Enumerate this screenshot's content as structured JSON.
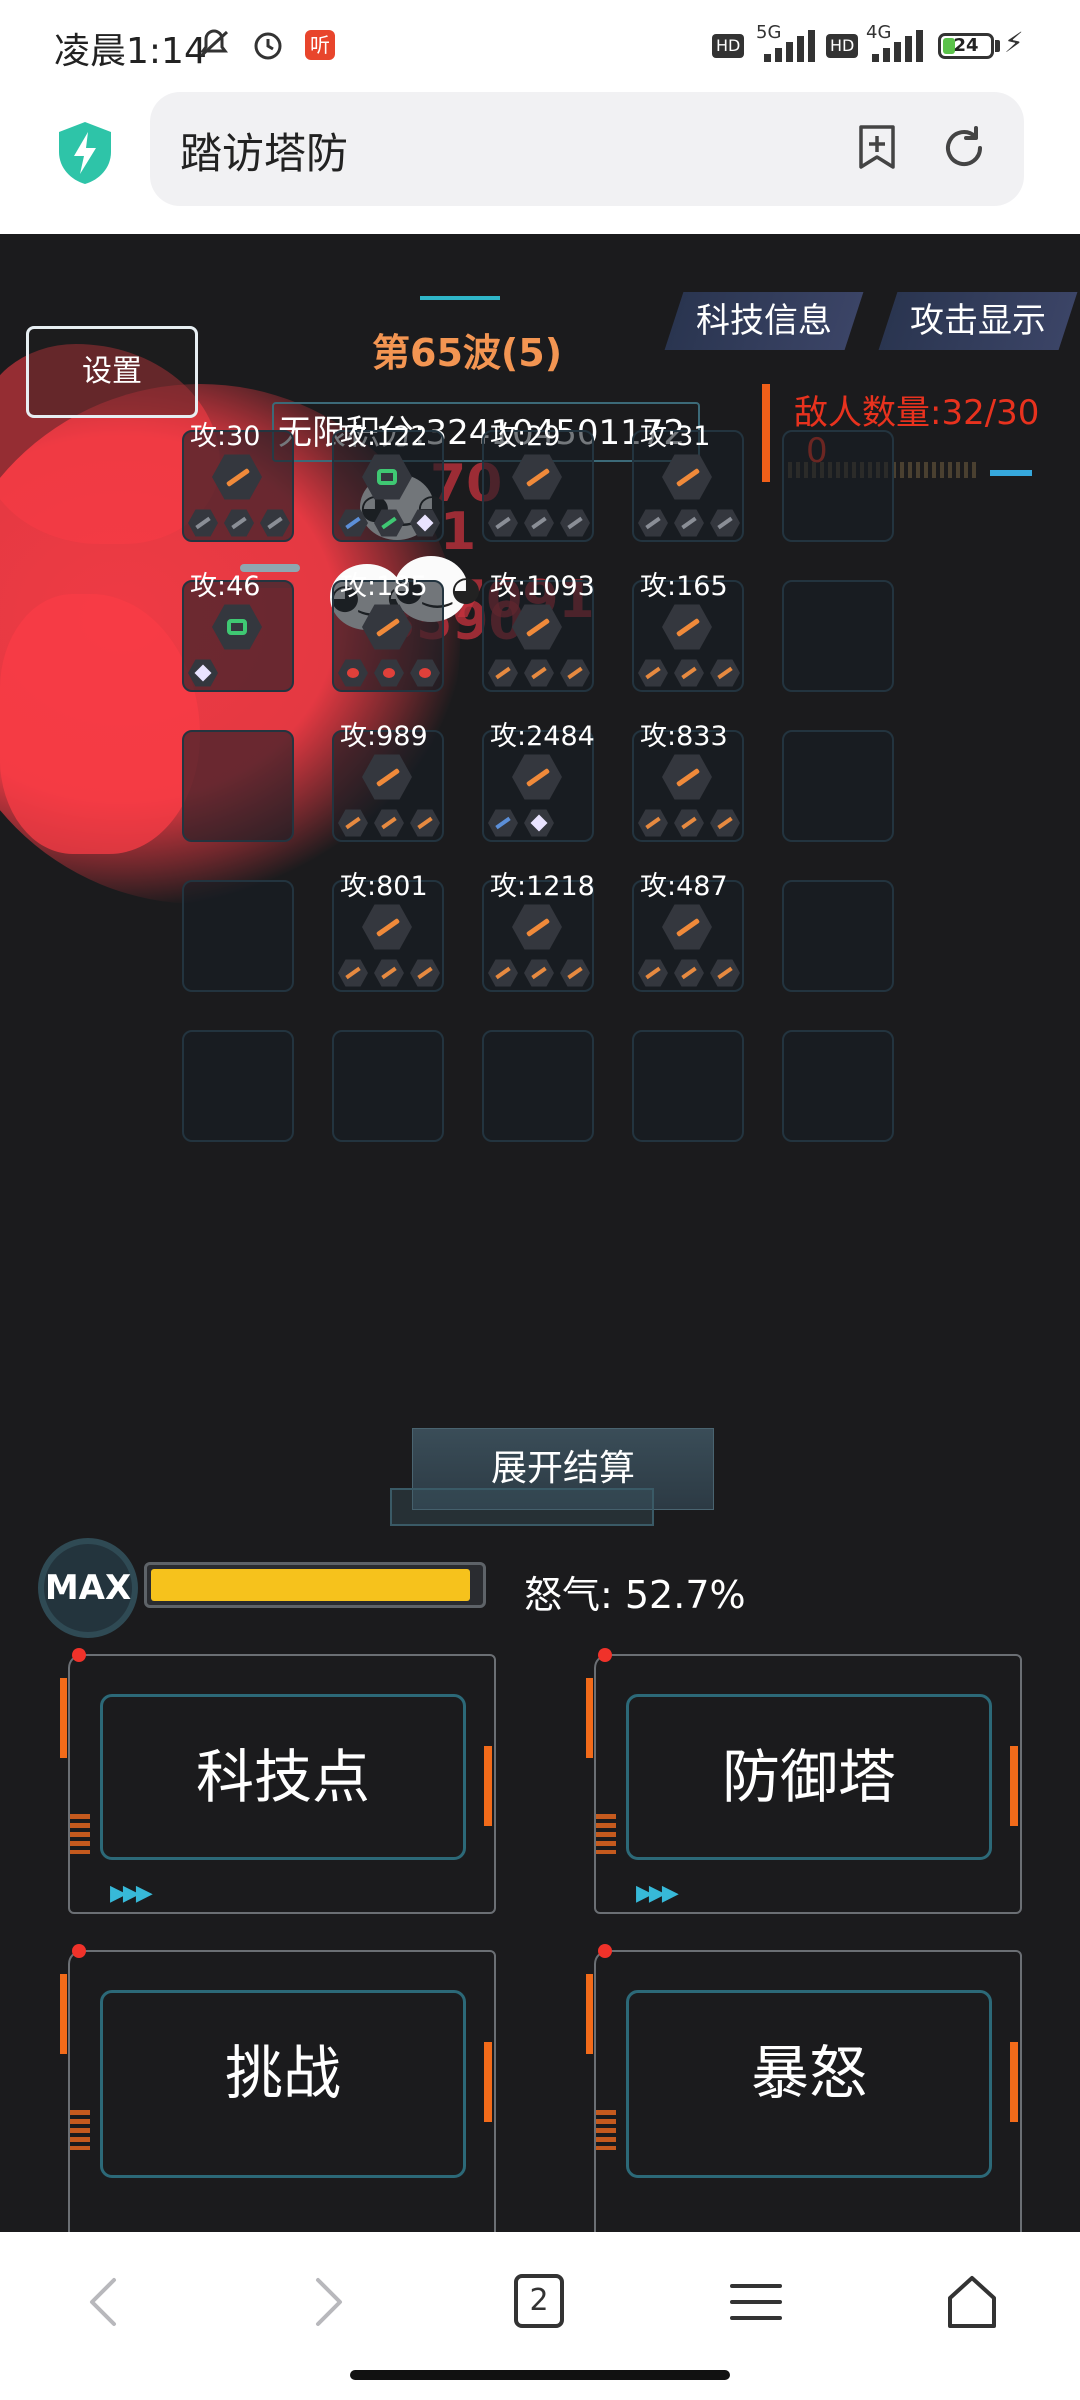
{
  "status_bar": {
    "time": "凌晨1:14",
    "icon_mute": "bell-off-icon",
    "icon_alarm": "alarm-icon",
    "app_badge": "听",
    "hd1": "HD",
    "net1": "5G",
    "hd2": "HD",
    "net2": "4G",
    "battery_level": "24",
    "battery_fraction": 0.24,
    "accent_green": "#5bc24a"
  },
  "browser": {
    "page_title": "踏访塔防",
    "icons": [
      "shield-bolt-icon",
      "bookmark-add-icon",
      "refresh-icon"
    ],
    "shield_color": "#2ec4a8"
  },
  "game": {
    "settings_label": "设置",
    "wave_label": "第65波(5)",
    "tabs": [
      "科技信息",
      "攻击显示"
    ],
    "score_label": "无限积分:324104501172",
    "enemy_line1": "敌人数量:32/30",
    "enemy_line2": "0",
    "floating_damage": [
      "70",
      "1",
      "7091",
      "3590"
    ],
    "towers": [
      {
        "atk": "攻:30",
        "icon": "orange"
      },
      {
        "atk": "攻:122",
        "icon": "green"
      },
      {
        "atk": "攻:29",
        "icon": "orange"
      },
      {
        "atk": "攻:31",
        "icon": "orange"
      },
      {
        "atk": "攻:46",
        "icon": "green"
      },
      {
        "atk": "攻:185",
        "icon": "orange"
      },
      {
        "atk": "攻:1093",
        "icon": "orange"
      },
      {
        "atk": "攻:165",
        "icon": "orange"
      },
      {
        "atk": "攻:989",
        "icon": "orange"
      },
      {
        "atk": "攻:2484",
        "icon": "orange"
      },
      {
        "atk": "攻:833",
        "icon": "orange"
      },
      {
        "atk": "攻:801",
        "icon": "orange"
      },
      {
        "atk": "攻:1218",
        "icon": "orange"
      },
      {
        "atk": "攻:487",
        "icon": "orange"
      }
    ],
    "expand_label": "展开结算",
    "max_label": "MAX",
    "rage_text": "怒气: 52.7%",
    "rage_fraction": 0.973,
    "rage_color": "#f6c21c",
    "actions": [
      "科技点",
      "防御塔",
      "挑战",
      "暴怒"
    ]
  },
  "bottom_nav": {
    "tab_count": "2",
    "icons": [
      "back-icon",
      "forward-icon",
      "tabs-icon",
      "menu-icon",
      "home-icon"
    ]
  }
}
